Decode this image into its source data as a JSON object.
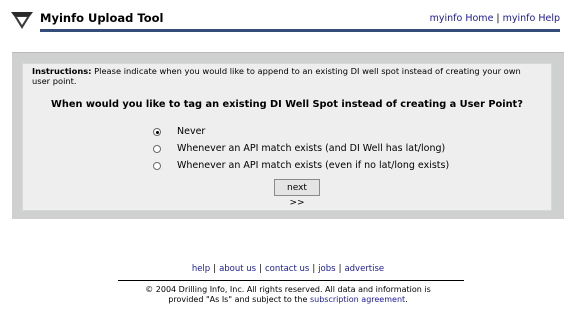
{
  "header": {
    "title": "Myinfo Upload Tool",
    "links": [
      "myinfo Home",
      "myinfo Help"
    ]
  },
  "form": {
    "instructions_label": "Instructions:",
    "instructions_text": " Please indicate when you would like to append to an existing DI well spot instead of creating your own user point.",
    "question": "When would you like to tag an existing DI Well Spot instead of creating a User Point?",
    "options": [
      {
        "label": "Never",
        "selected": true
      },
      {
        "label": "Whenever an API match exists (and DI Well has lat/long)",
        "selected": false
      },
      {
        "label": "Whenever an API match exists (even if no lat/long exists)",
        "selected": false
      }
    ],
    "next_label": "next >>"
  },
  "footer": {
    "links": [
      "help",
      "about us",
      "contact us",
      "jobs",
      "advertise"
    ],
    "copyright_line1": "© 2004 Drilling Info, Inc. All rights reserved. All data and information is",
    "copyright_line2_prefix": "provided \"As Is\" and subject to the ",
    "copyright_link": "subscription agreement",
    "copyright_line2_suffix": "."
  },
  "colors": {
    "accent_rule": "#334c7a",
    "link": "#1a1a9a",
    "panel": "#cfd1d0",
    "inner": "#eeeeee"
  }
}
